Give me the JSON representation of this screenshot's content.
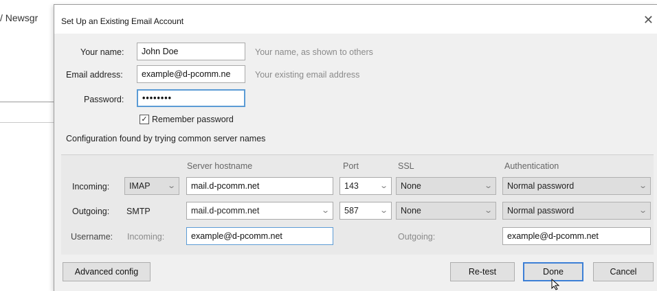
{
  "background": {
    "partial_text": "/ Newsgr"
  },
  "dialog": {
    "title": "Set Up an Existing Email Account",
    "close_glyph": "✕"
  },
  "form": {
    "name_label": "Your name:",
    "name_value": "John Doe",
    "name_hint": "Your name, as shown to others",
    "email_label": "Email address:",
    "email_value": "example@d-pcomm.ne",
    "email_hint": "Your existing email address",
    "password_label": "Password:",
    "password_value": "••••••••",
    "remember_label": "Remember password",
    "remember_checked": true,
    "config_status": "Configuration found by trying common server names"
  },
  "server": {
    "headers": {
      "hostname": "Server hostname",
      "port": "Port",
      "ssl": "SSL",
      "auth": "Authentication"
    },
    "incoming": {
      "label": "Incoming:",
      "protocol": "IMAP",
      "hostname": "mail.d-pcomm.net",
      "port": "143",
      "ssl": "None",
      "auth": "Normal password"
    },
    "outgoing": {
      "label": "Outgoing:",
      "protocol": "SMTP",
      "hostname": "mail.d-pcomm.net",
      "port": "587",
      "ssl": "None",
      "auth": "Normal password"
    },
    "username": {
      "label": "Username:",
      "incoming_label": "Incoming:",
      "incoming_value": "example@d-pcomm.net",
      "outgoing_label": "Outgoing:",
      "outgoing_value": "example@d-pcomm.net"
    }
  },
  "buttons": {
    "advanced": "Advanced config",
    "retest": "Re-test",
    "done": "Done",
    "cancel": "Cancel"
  },
  "colors": {
    "focus_border": "#5b9bd5",
    "primary_border": "#3c7fd6"
  },
  "icons": {
    "close": "close-icon",
    "chevron": "chevron-down-icon",
    "check": "checkmark-icon",
    "cursor": "mouse-pointer-icon"
  }
}
